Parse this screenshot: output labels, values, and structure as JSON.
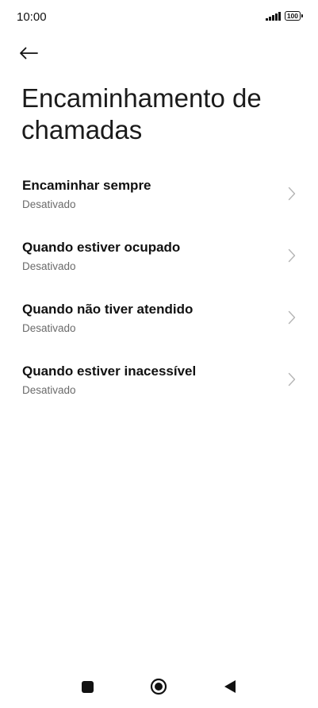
{
  "status_bar": {
    "time": "10:00",
    "battery": "100"
  },
  "header": {
    "back_icon": "arrow-left-icon",
    "title": "Encaminhamento de chamadas"
  },
  "settings": {
    "items": [
      {
        "title": "Encaminhar sempre",
        "subtitle": "Desativado"
      },
      {
        "title": "Quando estiver ocupado",
        "subtitle": "Desativado"
      },
      {
        "title": "Quando não tiver atendido",
        "subtitle": "Desativado"
      },
      {
        "title": "Quando estiver inacessível",
        "subtitle": "Desativado"
      }
    ]
  },
  "nav_bar": {
    "icons": [
      "square-recents-icon",
      "circle-home-icon",
      "triangle-back-icon"
    ]
  },
  "colors": {
    "background": "#ffffff",
    "text_primary": "#111111",
    "text_secondary": "#6b6b6b",
    "chevron": "#b5b5b5"
  }
}
